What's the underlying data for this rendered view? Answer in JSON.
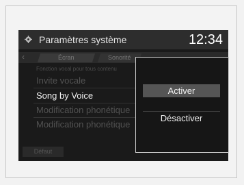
{
  "header": {
    "title": "Paramètres système",
    "clock": "12:34",
    "gear_icon": "gear-icon"
  },
  "tabs": [
    {
      "label": "Écran"
    },
    {
      "label": "Sonorité"
    }
  ],
  "list": {
    "subtitle": "Fonction vocal pour tous contenu",
    "items": [
      {
        "label": "Invite vocale"
      },
      {
        "label": "Song by Voice"
      },
      {
        "label": "Modification phonétique"
      },
      {
        "label": "Modification phonétique"
      }
    ]
  },
  "footer": {
    "left_button": "Défaut"
  },
  "popup": {
    "on_label": "Activer",
    "off_label": "Désactiver"
  }
}
